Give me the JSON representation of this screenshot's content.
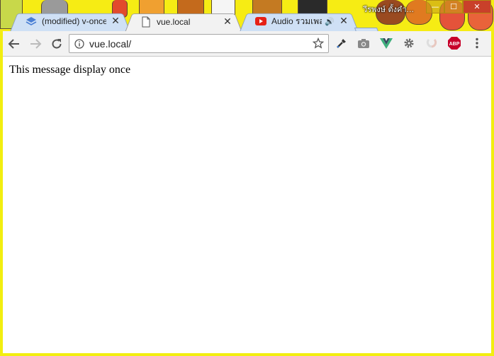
{
  "window": {
    "profile_name": "วีรพงษ์ ตั้งคำ...",
    "minimize": "—",
    "maximize": "☐",
    "close": "✕"
  },
  "tabs": [
    {
      "title": "(modified) v-once -",
      "icon": "layers-icon",
      "active": false
    },
    {
      "title": "vue.local",
      "icon": "document-icon",
      "active": true
    },
    {
      "title": "Audio รวมเพลงแ",
      "icon": "youtube-icon",
      "active": false,
      "audio": "🔊"
    }
  ],
  "toolbar": {
    "url": "vue.local/"
  },
  "extensions": [
    "eyedropper-icon",
    "camera-icon",
    "vue-devtools-icon",
    "gear-icon",
    "disabled-extension-icon",
    "adblock-plus-icon",
    "menu-icon"
  ],
  "extension_labels": {
    "abp": "ABP"
  },
  "content": {
    "message": "This message display once"
  },
  "colors": {
    "theme": "#f2ee10",
    "tab_inactive": "#cfe0f5",
    "tab_active": "#f2f2f2",
    "vue_green": "#3eaf7c",
    "abp_red": "#c7002a",
    "youtube_red": "#e62117"
  }
}
